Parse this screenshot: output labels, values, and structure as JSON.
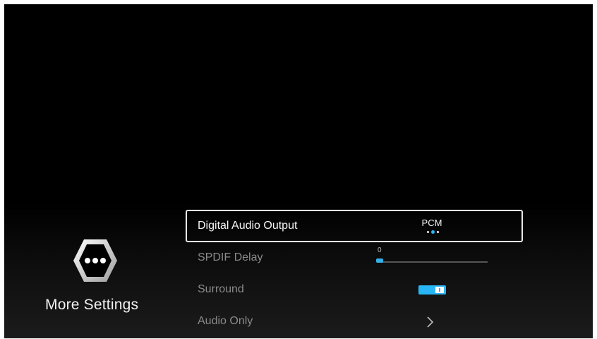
{
  "side_panel": {
    "icon": "more-dots-icon",
    "title": "More Settings"
  },
  "menu": {
    "items": [
      {
        "label": "Digital Audio Output",
        "type": "selector",
        "value": "PCM",
        "option_count": 3,
        "selected_index": 1,
        "focused": true
      },
      {
        "label": "SPDIF Delay",
        "type": "slider",
        "value": "0",
        "level": 0
      },
      {
        "label": "Surround",
        "type": "toggle",
        "state": "on"
      },
      {
        "label": "Audio Only",
        "type": "submenu",
        "icon": "chevron-right-icon"
      }
    ]
  },
  "colors": {
    "accent": "#29b6f6",
    "background": "#000000",
    "focus_border": "#e8e8e8",
    "inactive_text": "#8a8a8a"
  }
}
